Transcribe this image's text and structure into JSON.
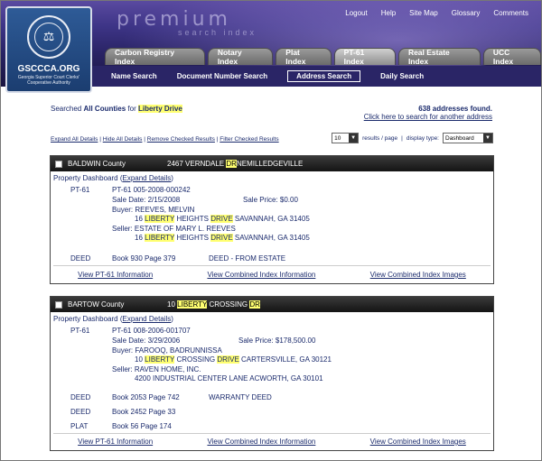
{
  "header": {
    "brand": "premium",
    "tagline": "search index",
    "top_links": [
      "Logout",
      "Help",
      "Site Map",
      "Glossary",
      "Comments"
    ],
    "logo": {
      "name": "GSCCCA.ORG",
      "subtitle_line1": "Georgia Superior Court Clerks'",
      "subtitle_line2": "Cooperative Authority"
    },
    "tabs": [
      "Carbon Registry Index",
      "Notary Index",
      "Plat Index",
      "PT-61 Index",
      "Real Estate Index",
      "UCC Index"
    ],
    "active_tab": "PT-61 Index",
    "subnav": [
      "Name Search",
      "Document Number Search",
      "Address Search",
      "Daily Search"
    ],
    "active_subnav": "Address Search"
  },
  "search": {
    "prefix": "Searched",
    "scope": "All Counties",
    "for_word": "for",
    "term": "Liberty Drive",
    "found": "638 addresses found.",
    "new_search_link": "Click here to search for another address"
  },
  "actions": {
    "expand_all": "Expand All Details",
    "hide_all": "Hide All Details",
    "remove_checked": "Remove Checked Results",
    "filter_checked": "Filter Checked Results",
    "sep": "|",
    "per_page_value": "10",
    "per_page_label": "results / page",
    "display_type_label": "display type:",
    "display_type_value": "Dashboard"
  },
  "records": [
    {
      "county": "BALDWIN County",
      "address_pre": "2467 VERNDALE",
      "address_hl": "DR",
      "address_post": "NEMILLEDGEVILLE",
      "dashboard_label": "Property Dashboard",
      "expand_label": "Expand Details",
      "pt61_label": "PT-61",
      "pt61_number": "PT-61 005-2008-000242",
      "sale_date": "Sale Date: 2/15/2008",
      "sale_price": "Sale Price: $0.00",
      "buyer": "Buyer: REEVES, MELVIN",
      "buyer_addr": [
        "16",
        "LIBERTY",
        "HEIGHTS",
        "DRIVE",
        "SAVANNAH, GA 31405"
      ],
      "seller": "Seller: ESTATE OF MARY L. REEVES",
      "seller_addr": [
        "16",
        "LIBERTY",
        "HEIGHTS",
        "DRIVE",
        "SAVANNAH, GA 31405"
      ],
      "deeds": [
        {
          "type": "DEED",
          "book": "Book 930 Page 379",
          "desc": "DEED - FROM ESTATE"
        }
      ],
      "links": [
        "View PT-61 Information",
        "View Combined Index Information",
        "View Combined Index Images"
      ]
    },
    {
      "county": "BARTOW County",
      "address_pre": "10",
      "address_hl1": "LIBERTY",
      "address_mid": "CROSSING",
      "address_hl2": "DR",
      "dashboard_label": "Property Dashboard",
      "expand_label": "Expand Details",
      "pt61_label": "PT-61",
      "pt61_number": "PT-61 008-2006-001707",
      "sale_date": "Sale Date: 3/29/2006",
      "sale_price": "Sale Price: $178,500.00",
      "buyer": "Buyer: FAROOQ, BADRUNNISSA",
      "buyer_addr": [
        "10",
        "LIBERTY",
        "CROSSING",
        "DRIVE",
        "CARTERSVILLE, GA 30121"
      ],
      "seller": "Seller: RAVEN HOME, INC.",
      "seller_addr_text": "4200 INDUSTRIAL CENTER LANE ACWORTH, GA 30101",
      "deeds": [
        {
          "type": "DEED",
          "book": "Book 2053 Page 742",
          "desc": "WARRANTY DEED"
        },
        {
          "type": "DEED",
          "book": "Book 2452 Page 33",
          "desc": ""
        },
        {
          "type": "PLAT",
          "book": "Book 56 Page 174",
          "desc": ""
        }
      ],
      "links": [
        "View PT-61 Information",
        "View Combined Index Information",
        "View Combined Index Images"
      ]
    }
  ]
}
